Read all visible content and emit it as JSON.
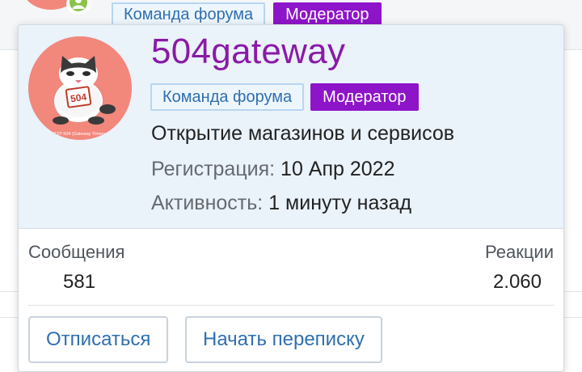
{
  "background": {
    "badges": [
      {
        "label": "Команда форума",
        "kind": "team"
      },
      {
        "label": "Модератор",
        "kind": "moderator"
      }
    ]
  },
  "profile": {
    "username": "504gateway",
    "badges": [
      {
        "label": "Команда форума",
        "kind": "team"
      },
      {
        "label": "Модератор",
        "kind": "moderator"
      }
    ],
    "user_title": "Открытие магазинов и сервисов",
    "registration_label": "Регистрация:",
    "registration_value": "10 Апр 2022",
    "activity_label": "Активность:",
    "activity_value": "1 минуту назад",
    "avatar_text": {
      "number": "504",
      "caption": "HTTP 504 (Gateway Timeout)"
    }
  },
  "stats": {
    "messages_label": "Сообщения",
    "messages_value": "581",
    "reactions_label": "Реакции",
    "reactions_value": "2.060"
  },
  "actions": {
    "unfollow_label": "Отписаться",
    "start_conversation_label": "Начать переписку"
  },
  "colors": {
    "username": "#8a1aa8",
    "moderator_badge": "#8e14c9",
    "team_badge_text": "#2f6fb0",
    "header_bg": "#eaf2fa",
    "avatar_bg": "#f2877c",
    "online_indicator": "#8bc34a"
  }
}
